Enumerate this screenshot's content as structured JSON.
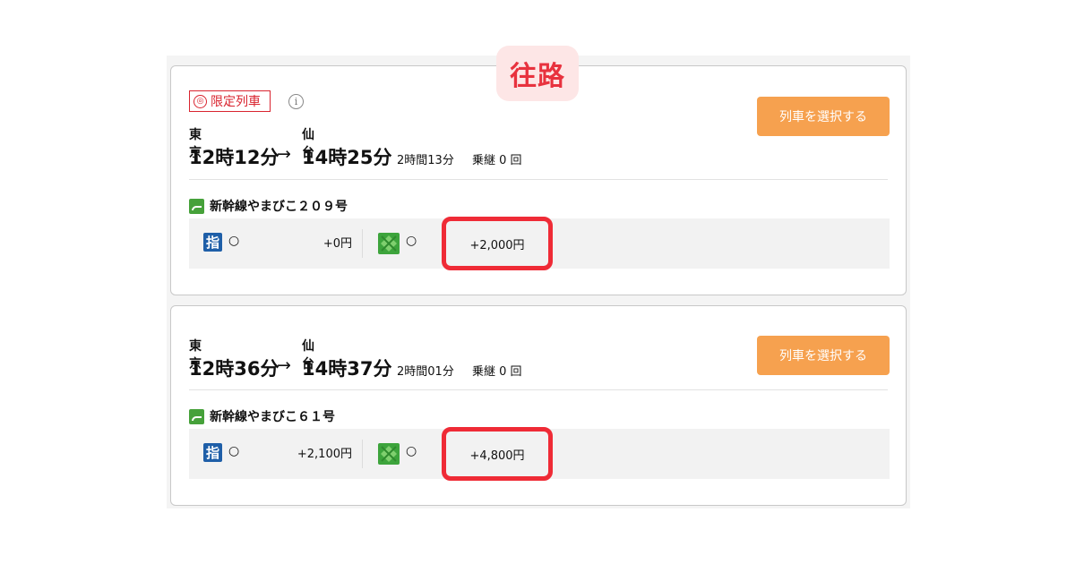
{
  "header": {
    "outbound_label": "往路"
  },
  "icons": {
    "reserved": "reserved-seat-icon",
    "green": "green-car-icon",
    "train": "shinkansen-icon",
    "info": "info-icon",
    "limited": "limited-train-icon"
  },
  "colors": {
    "accent_red": "#e8323e",
    "button_orange": "#f6a14f",
    "reserved_blue": "#1f5fa8",
    "green_car": "#3da43c"
  },
  "trains": [
    {
      "limited_label": "限定列車",
      "info_glyph": "i",
      "from_station": "東京",
      "to_station": "仙台",
      "departure": "12時12分",
      "arrow": "→",
      "arrival": "14時25分",
      "duration": "2時間13分",
      "transfers": "乗継 0 回",
      "select_label": "列車を選択する",
      "train_name": "新幹線やまびこ２０９号",
      "reserved_icon_label": "指",
      "reserved_availability": "○",
      "reserved_price": "+0円",
      "green_availability": "○",
      "green_price": "+2,000円"
    },
    {
      "from_station": "東京",
      "to_station": "仙台",
      "departure": "12時36分",
      "arrow": "→",
      "arrival": "14時37分",
      "duration": "2時間01分",
      "transfers": "乗継 0 回",
      "select_label": "列車を選択する",
      "train_name": "新幹線やまびこ６１号",
      "reserved_icon_label": "指",
      "reserved_availability": "○",
      "reserved_price": "+2,100円",
      "green_availability": "○",
      "green_price": "+4,800円"
    }
  ]
}
